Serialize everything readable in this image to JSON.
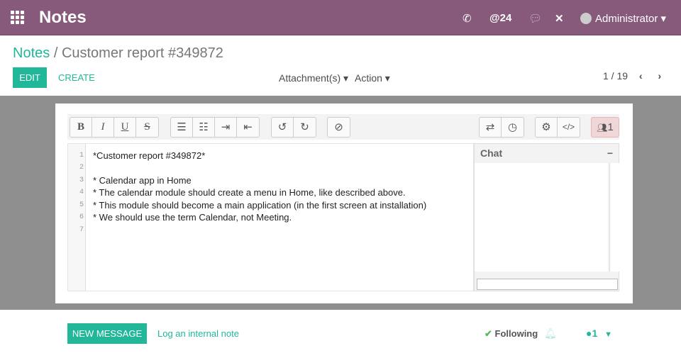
{
  "navbar": {
    "app_title": "Notes",
    "mentions_count": "@24",
    "user": "Administrator",
    "color": "#875A7B"
  },
  "breadcrumb": {
    "parent": "Notes",
    "separator": "/",
    "current": "Customer report #349872"
  },
  "controls": {
    "edit": "EDIT",
    "create": "CREATE",
    "attachments": "Attachment(s) ▾",
    "action": "Action ▾",
    "pager": "1 / 19"
  },
  "toolbar": {
    "collaborators": "1",
    "buttons": [
      "bold",
      "italic",
      "underline",
      "strikethrough",
      "ordered-list",
      "unordered-list",
      "indent",
      "outdent",
      "undo",
      "redo",
      "preview",
      "swap",
      "history",
      "settings",
      "embed",
      "users"
    ]
  },
  "editor": {
    "lines": [
      "*Customer report #349872*",
      "",
      "* Calendar app in Home",
      "* The calendar module should create a menu in Home, like described above.",
      "* This module should become a main application (in the first screen at installation)",
      "* We should use the term Calendar, not Meeting.",
      ""
    ],
    "line_numbers": [
      "1",
      "2",
      "3",
      "4",
      "5",
      "6",
      "7"
    ]
  },
  "chat": {
    "title": "Chat",
    "minimize": "−"
  },
  "chatter": {
    "new_message": "NEW MESSAGE",
    "log_note": "Log an internal note",
    "following": "Following",
    "followers": "1"
  },
  "accent": "#21b799"
}
